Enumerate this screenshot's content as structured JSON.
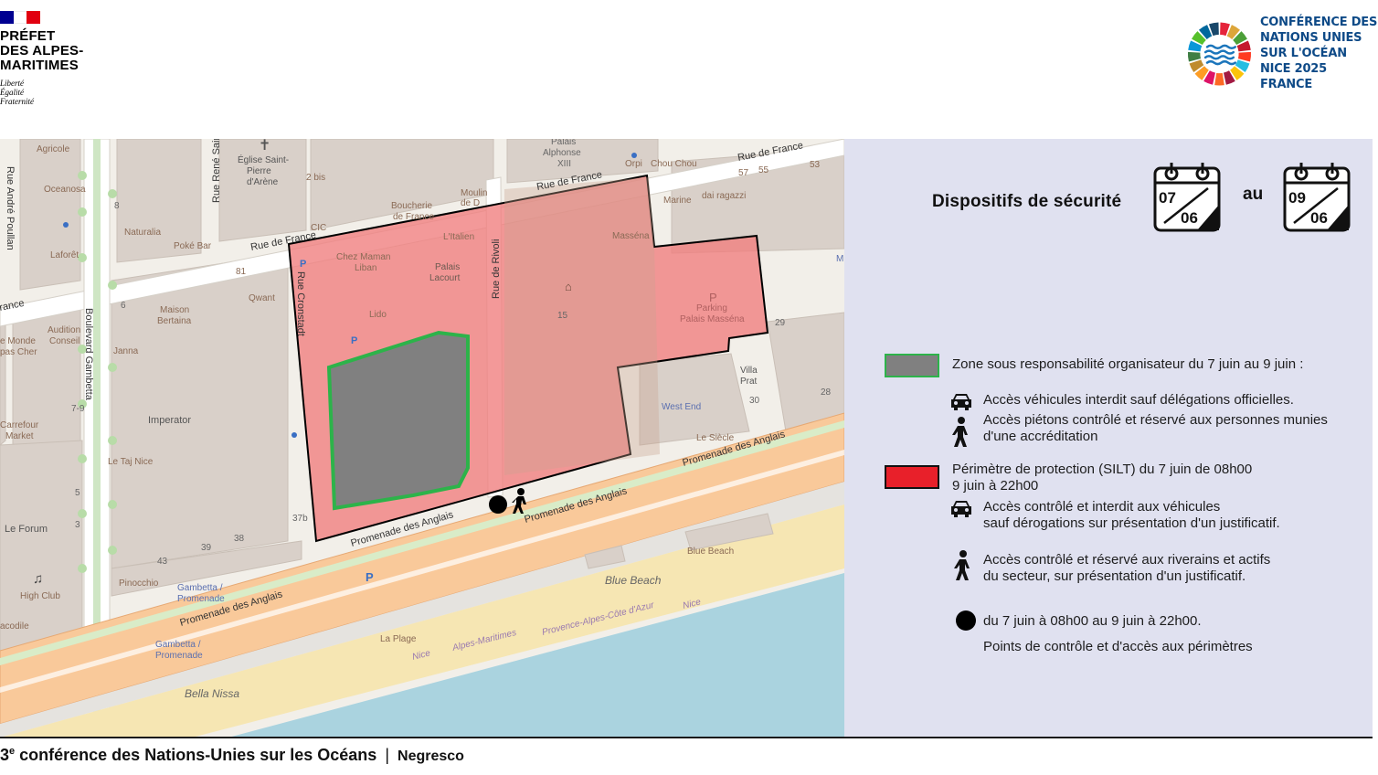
{
  "header": {
    "prefecture_lines": [
      "PRÉFET",
      "DES ALPES-",
      "MARITIMES"
    ],
    "motto_lines": [
      "Liberté",
      "Égalité",
      "Fraternité"
    ],
    "conference_lines": [
      "CONFÉRENCE DES",
      "NATIONS UNIES",
      "SUR L'OCÉAN",
      "NICE 2025 FRANCE"
    ]
  },
  "colors": {
    "flag_blue": "#000091",
    "flag_red": "#e1000f",
    "panel_bg": "#e0e1f0",
    "zone_fill": "#808080",
    "zone_border": "#2db34a",
    "perimeter_fill": "#f08080",
    "perimeter_swatch": "#e8202a",
    "promenade": "#f9c99a",
    "sea": "#aad3df",
    "beach": "#f6e6b3",
    "conference_text": "#0e4a87"
  },
  "panel": {
    "title": "Dispositifs de sécurité",
    "date_from": {
      "day": "07",
      "month": "06"
    },
    "connector": "au",
    "date_to": {
      "day": "09",
      "month": "06"
    },
    "legend": [
      {
        "swatch": "zone-organisateur",
        "title": "Zone sous responsabilité organisateur du 7 juin au 9 juin :",
        "items": [
          {
            "icon": "car-icon",
            "text": "Accès véhicules interdit sauf délégations officielles."
          },
          {
            "icon": "pedestrian-icon",
            "text": "Accès piétons contrôlé et réservé aux personnes munies d'une accréditation"
          }
        ]
      },
      {
        "swatch": "perimetre-protection",
        "title_lines": [
          "Périmètre de protection (SILT) du 7 juin de 08h00",
          "9 juin à 22h00"
        ],
        "items": [
          {
            "icon": "car-icon",
            "text_lines": [
              "Accès contrôlé et interdit aux véhicules",
              "sauf dérogations sur présentation d'un justificatif."
            ]
          },
          {
            "icon": "pedestrian-icon",
            "text_lines": [
              "Accès contrôlé et réservé aux riverains et actifs",
              "du secteur, sur présentation d'un justificatif."
            ]
          }
        ]
      },
      {
        "swatch": "checkpoint-dot",
        "title": "du 7 juin à 08h00 au 9 juin à 22h00.",
        "subtitle": "Points de contrôle et d'accès aux périmètres"
      }
    ]
  },
  "map": {
    "streets": {
      "rue_de_france": "Rue de France",
      "promenade": "Promenade des Anglais",
      "boulevard_gambetta": "Boulevard Gambetta",
      "rue_andre_poullan": "Rue André Poullan",
      "rue_rene_sair": "Rue René Sair",
      "rue_cronstadt": "Rue Cronstadt",
      "rue_de_rivoli": "Rue de Rivoli",
      "rance": "rance"
    },
    "pois": {
      "agricole": "Agricole",
      "oceanosa": "Oceanosa",
      "laforet": "Laforêt",
      "naturalia": "Naturalia",
      "poke_bar": "Poké Bar",
      "eglise": "Église Saint-\nPierre\nd'Arène",
      "deux_bis": "2 bis",
      "cic": "CIC",
      "boucherie": "Boucherie\nde France",
      "palais_alphonse": "Palais\nAlphonse\nXIII",
      "moulin": "Moulin\nde D",
      "orpi": "Orpi",
      "chou_chou": "Chou Chou",
      "marine": "Marine",
      "dai_ragazzi": "dai ragazzi",
      "n57": "57",
      "n55": "55",
      "n53": "53",
      "chez_maman": "Chez Maman\nLiban",
      "l_italien": "L'Italien",
      "massena": "Masséna",
      "palais_lacourt": "Palais\nLacourt",
      "lido": "Lido",
      "n81": "81",
      "qwant": "Qwant",
      "maison_bertaina": "Maison\nBertaina",
      "audition": "Audition\nConseil",
      "monde": "e Monde\npas Cher",
      "janna": "Janna",
      "carrefour": "Carrefour\nMarket",
      "imperator": "Imperator",
      "le_taj": "Le Taj Nice",
      "le_forum": "Le Forum",
      "high_club": "High Club",
      "acodile": "acodile",
      "pinocchio": "Pinocchio",
      "gambetta_promenade": "Gambetta /\nPromenade",
      "n43": "43",
      "n39": "39",
      "n38": "38",
      "n37b": "37b",
      "parking": "Parking\nPalais Masséna",
      "n29": "29",
      "villa_prat": "Villa\nPrat",
      "n30": "30",
      "n28": "28",
      "west_end": "West End",
      "le_siecle": "Le Siècle",
      "blue_beach": "Blue Beach",
      "blue_beach_label": "Blue Beach",
      "la_plage": "La Plage",
      "nice": "Nice",
      "alpes_maritimes": "Alpes-Maritimes",
      "provence": "Provence-Alpes-Côte d'Azur",
      "nice2": "Nice",
      "bella_nissa": "Bella Nissa",
      "n7_9": "7-9",
      "n6": "6",
      "n5": "5",
      "n3": "3",
      "n8": "8",
      "n15": "15",
      "m": "M"
    }
  },
  "footer": {
    "title_prefix": "3",
    "title_superscript": "e",
    "title_rest": " conférence des Nations-Unies sur les Océans",
    "separator": "|",
    "location": "Negresco"
  }
}
